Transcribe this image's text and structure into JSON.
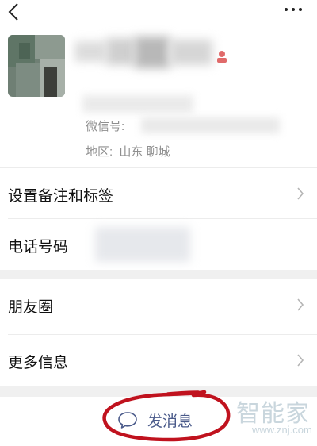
{
  "header": {
    "back_icon": "chevron-left-icon",
    "more_icon": "more-dots-icon"
  },
  "profile": {
    "wechat_id_label": "微信号:",
    "region_label": "地区:",
    "region_value": "山东  聊城"
  },
  "menu": {
    "remark_tags": "设置备注和标签",
    "phone": "电话号码",
    "moments": "朋友圈",
    "more_info": "更多信息"
  },
  "footer": {
    "send_message": "发消息",
    "send_icon": "chat-bubble-icon"
  },
  "watermark": {
    "title": "智能家",
    "url": "www.znj.com"
  },
  "colors": {
    "annotation_red": "#c0121e",
    "send_text": "#4a5a8a",
    "muted_text": "#8f8f8f"
  }
}
